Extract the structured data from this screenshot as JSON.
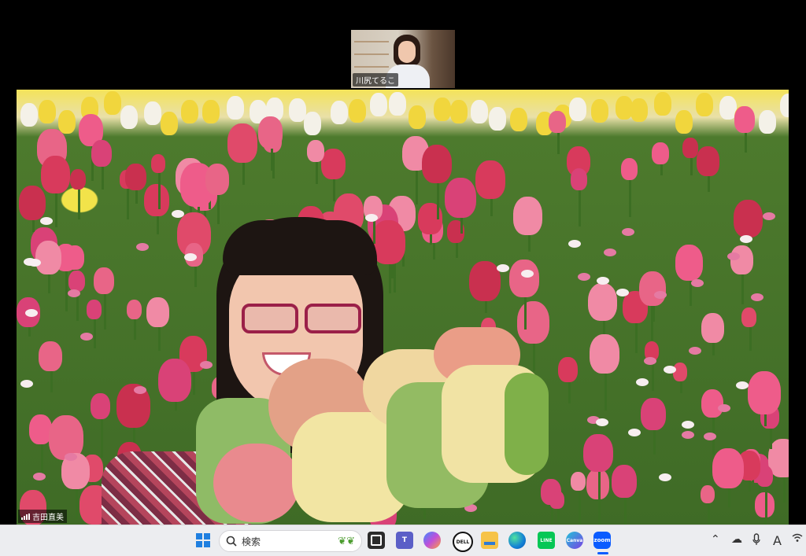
{
  "participants": {
    "thumbnail": {
      "name": "川尻てるこ"
    },
    "speaker": {
      "name": "吉田直美"
    }
  },
  "taskbar": {
    "search_placeholder": "検索",
    "apps": [
      "windows-start",
      "task-view",
      "teams",
      "copilot",
      "dell",
      "file-explorer",
      "edge",
      "line",
      "canva",
      "zoom"
    ],
    "app_labels": {
      "dell": "DELL",
      "zoom": "zoom",
      "canva": "Canva",
      "line": "LINE"
    },
    "tray": [
      "chevron-up-icon",
      "cloud-icon",
      "microphone-icon",
      "font-icon",
      "wifi-icon"
    ],
    "tray_font_label": "A"
  }
}
